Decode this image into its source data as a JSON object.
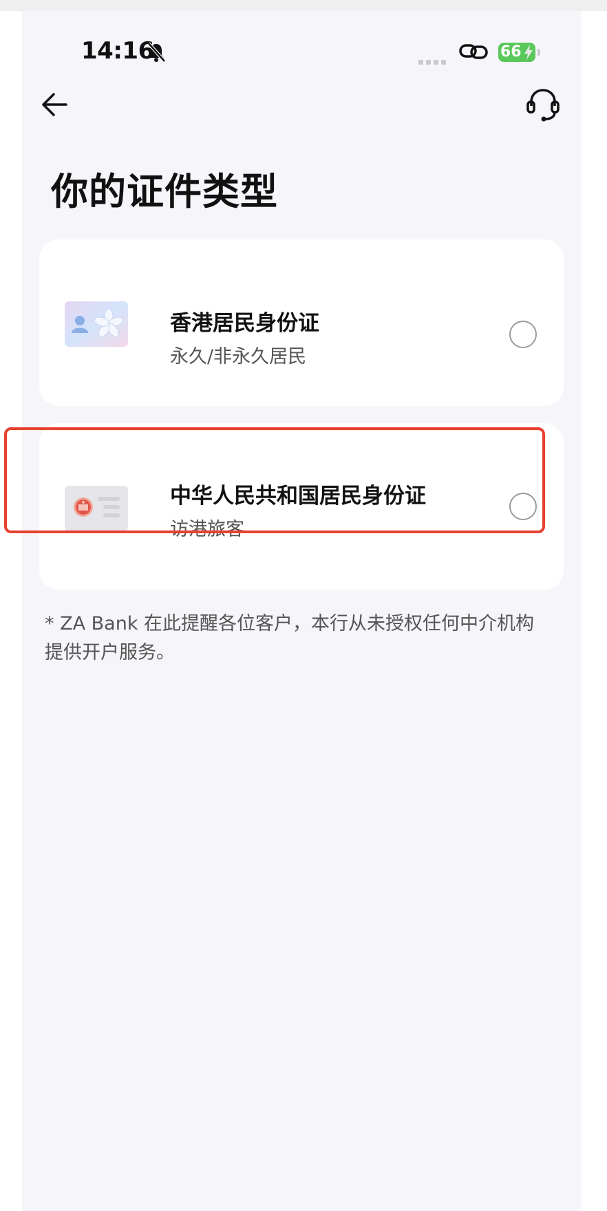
{
  "status_bar": {
    "time": "14:16",
    "battery": "66"
  },
  "header": {
    "back_icon": "arrow-left-icon",
    "support_icon": "headset-icon"
  },
  "page": {
    "title": "你的证件类型"
  },
  "options": [
    {
      "title": "香港居民身份证",
      "subtitle": "永久/非永久居民",
      "icon": "hk-id-card-icon",
      "selected": false
    },
    {
      "title": "中华人民共和国居民身份证",
      "subtitle": "访港旅客",
      "icon": "prc-id-card-icon",
      "selected": false
    }
  ],
  "notice": {
    "line1": "* ZA Bank 在此提醒各位客户，本行从未授权任何中介机构",
    "line2": "提供开户服务。"
  },
  "colors": {
    "background": "#f5f5fa",
    "card": "#ffffff",
    "highlight": "#e8412f",
    "battery": "#5ac85a"
  }
}
